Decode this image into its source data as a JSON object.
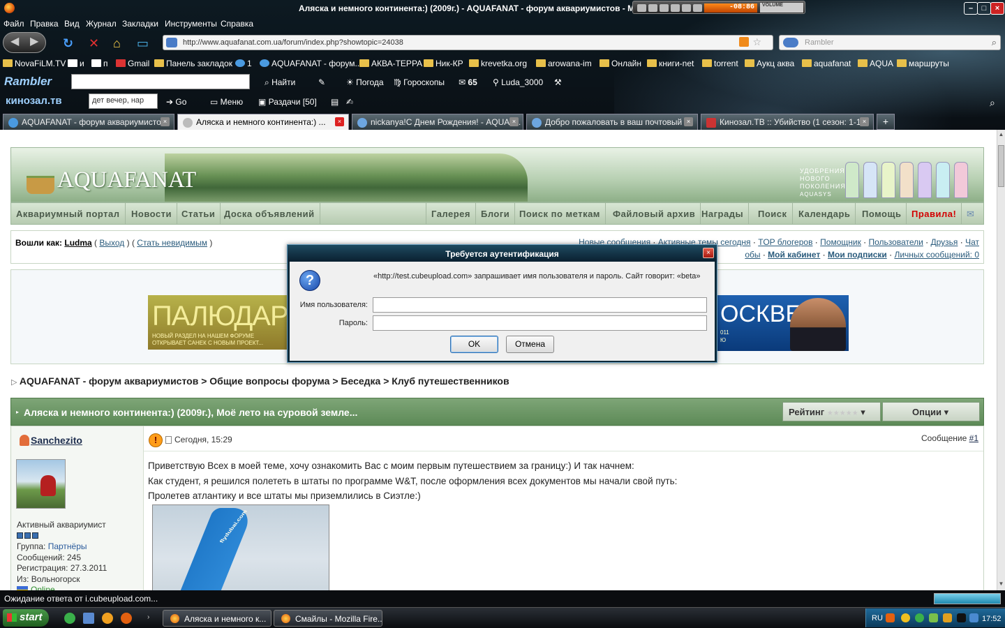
{
  "window": {
    "title": "Аляска и немного континента:) (2009г.) - AQUAFANAT - форум аквариумистов - Mozilla Firefox",
    "player_time": "-08:86",
    "player_volume": "VOLUME"
  },
  "menu": [
    "Файл",
    "Правка",
    "Вид",
    "Журнал",
    "Закладки",
    "Инструменты",
    "Справка"
  ],
  "nav": {
    "url": "http://www.aquafanat.com.ua/forum/index.php?showtopic=24038",
    "search_placeholder": "Rambler"
  },
  "bookmarks": [
    "NovaFiLM.TV",
    "и",
    "п",
    "Gmail",
    "Панель закладок",
    "1",
    "AQUAFANAT - форум...",
    "АКВА-ТЕРРА",
    "Ник-КР",
    "krevetka.org",
    "arowana-im",
    "Онлайн",
    "книги-net",
    "torrent",
    "Аукц аква",
    "aquafanat",
    "AQUA",
    "маршруты"
  ],
  "toolbar_rambler": {
    "brand": "Rambler",
    "find": "Найти",
    "weather": "Погода",
    "horoscope": "Гороскопы",
    "count": "65",
    "user": "Luda_3000"
  },
  "toolbar_kino": {
    "brand": "кинозал.тв",
    "query": "дет вечер, нар",
    "go": "Go",
    "menu": "Меню",
    "distrib": "Раздачи [50]"
  },
  "tabs": [
    {
      "label": "AQUAFANAT - форум аквариумистов",
      "active": false
    },
    {
      "label": "Аляска и немного континента:) ...",
      "active": true
    },
    {
      "label": "nickanya!С Днем Рождения! - AQUAF...",
      "active": false
    },
    {
      "label": "Добро пожаловать в ваш почтовый ...",
      "active": false
    },
    {
      "label": "Кинозал.ТВ :: Убийство (1 сезон: 1-1...",
      "active": false
    }
  ],
  "site": {
    "logo": "AQUAFANAT",
    "slogan": [
      "удобрения",
      "нового",
      "поколения",
      "AQUASYS"
    ],
    "nav_left": [
      "Аквариумный портал",
      "Новости",
      "Статьи",
      "Доска объявлений"
    ],
    "nav_right": [
      "Галерея",
      "Блоги",
      "Поиск по меткам",
      "Файловый архив",
      "Награды",
      "Поиск",
      "Календарь",
      "Помощь",
      "Правила!"
    ]
  },
  "login": {
    "prefix": "Вошли как:",
    "user": "Ludma",
    "logout": "Выход",
    "invisible": "Стать невидимым",
    "row1": [
      "Новые сообщения",
      "Активные темы сегодня",
      "TOP блогеров",
      "Помощник",
      "Пользователи",
      "Друзья",
      "Чат"
    ],
    "row2_lead": "обы",
    "cabinet": "Мой кабинет",
    "subs": "Мои подписки",
    "pm": "Личных сообщений: 0"
  },
  "ads": {
    "left_big": "ПАЛЮДАРИУМ",
    "left_small": [
      "НОВЫЙ РАЗДЕЛ НА НАШЕМ ФОРУМЕ",
      "ОТКРЫВАЕТ САНЕК С НОВЫМ ПРОЕКТ..."
    ],
    "right_big": "ОСКВЕ",
    "right_small": [
      "011",
      "Ю"
    ]
  },
  "breadcrumb": [
    "AQUAFANAT - форум аквариумистов",
    "Общие вопросы форума",
    "Беседка",
    "Клуб путешественников"
  ],
  "thread": {
    "title": "Аляска и немного континента:) (2009г.), Моё лето на суровой земле...",
    "rating": "Рейтинг",
    "stars": "★★★★★",
    "options": "Опции"
  },
  "post": {
    "author": "Sanchezito",
    "rank": "Активный аквариумист",
    "group_label": "Группа:",
    "group": "Партнёры",
    "posts": "Сообщений: 245",
    "reg": "Регистрация: 27.3.2011",
    "from": "Из: Вольногорск",
    "status": "Online",
    "date": "Сегодня, 15:29",
    "num_label": "Сообщение",
    "num": "#1",
    "lines": [
      "Приветствую Всех в моей теме, хочу ознакомить Вас с моим первым путешествием за границу:) И так начнем:",
      "Как студент, я решился полететь в штаты по программе W&T, после оформления всех документов мы начали свой путь:",
      "Пролетев атлантику и все штаты мы приземлились в Сиэтле:)"
    ],
    "photo_text": "flydubai.com"
  },
  "dialog": {
    "title": "Требуется аутентификация",
    "message": "«http://test.cubeupload.com» запрашивает имя пользователя и пароль. Сайт говорит: «beta»",
    "user_label": "Имя пользователя:",
    "pass_label": "Пароль:",
    "ok": "OK",
    "cancel": "Отмена"
  },
  "status": "Ожидание ответа от i.cubeupload.com...",
  "taskbar": {
    "start": "start",
    "tasks": [
      "Аляска и немного к...",
      "Смайлы - Mozilla Fire..."
    ],
    "lang": "RU",
    "clock": "17:52"
  },
  "colors": {
    "forum_green": "#5d8a57",
    "link": "#2a5b7c",
    "rules_red": "#d20000",
    "chrome_dark": "#0a0f14"
  }
}
